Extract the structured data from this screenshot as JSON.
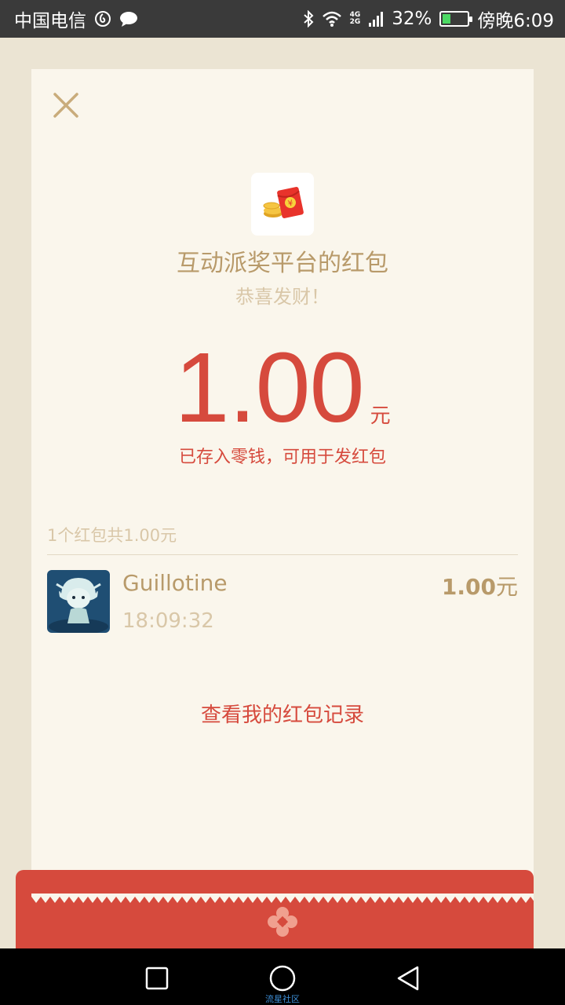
{
  "status_bar": {
    "carrier": "中国电信",
    "network_top": "4G",
    "network_bottom": "2G",
    "battery": "32%",
    "battery_level": 0.32,
    "time": "傍晚6:09"
  },
  "card": {
    "sender_title": "互动派奖平台的红包",
    "greeting": "恭喜发财！",
    "amount": "1.00",
    "amount_unit": "元",
    "amount_note": "已存入零钱，可用于发红包",
    "summary": "1个红包共1.00元",
    "records": [
      {
        "name": "Guillotine",
        "time": "18:09:32",
        "amount": "1.00",
        "unit": "元"
      }
    ],
    "history_link": "查看我的红包记录"
  },
  "watermark": "流星社区",
  "colors": {
    "accent_red": "#d64a3d",
    "gold_text": "#b89a6a",
    "light_gold": "#d9c7a8",
    "card_bg": "#faf6ec",
    "page_bg": "#ebe4d3"
  }
}
